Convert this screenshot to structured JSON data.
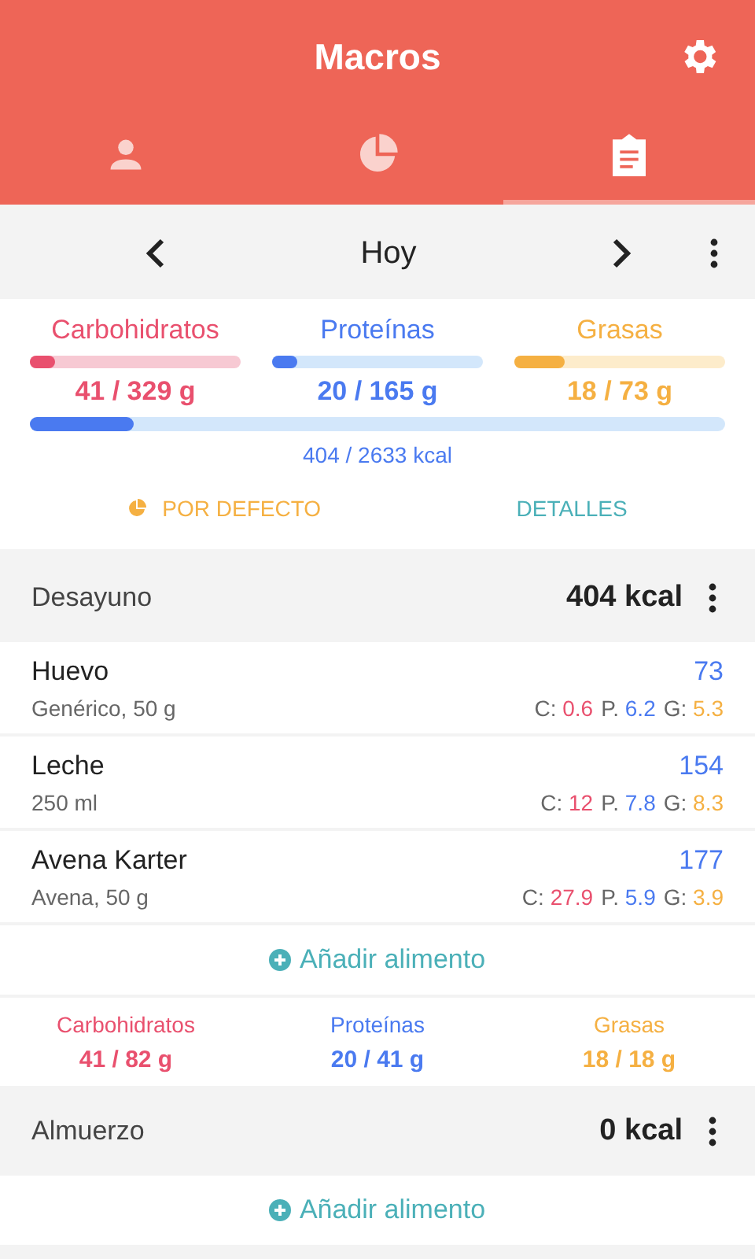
{
  "app_bar": {
    "title": "Macros"
  },
  "tabs": [
    {
      "kind": "person",
      "selected": false
    },
    {
      "kind": "pie",
      "selected": false
    },
    {
      "kind": "clipboard",
      "selected": true
    }
  ],
  "date_nav": {
    "label": "Hoy"
  },
  "summary": {
    "macros": [
      {
        "kind": "carbs",
        "label": "Carbohidratos",
        "value": "41 / 329 g",
        "level": 0.12
      },
      {
        "kind": "protein",
        "label": "Proteínas",
        "value": "20 / 165 g",
        "level": 0.12
      },
      {
        "kind": "fat",
        "label": "Grasas",
        "value": "18 / 73 g",
        "level": 0.24
      }
    ],
    "energy": {
      "level": 0.15,
      "value": "404 / 2633 kcal"
    },
    "actions": [
      {
        "kind": "preset",
        "label": "POR DEFECTO"
      },
      {
        "kind": "details",
        "label": "DETALLES"
      }
    ]
  },
  "meals": [
    {
      "name": "Desayuno",
      "kcal": "404 kcal",
      "foods": [
        {
          "name": "Huevo",
          "detail": "Genérico, 50 g",
          "kcal": "73",
          "macros": [
            {
              "kind": "carbs",
              "label": "C:",
              "value": "0.6"
            },
            {
              "kind": "protein",
              "label": "P.",
              "value": "6.2"
            },
            {
              "kind": "fat",
              "label": "G:",
              "value": "5.3"
            }
          ]
        },
        {
          "name": "Leche",
          "detail": "250 ml",
          "kcal": "154",
          "macros": [
            {
              "kind": "carbs",
              "label": "C:",
              "value": "12"
            },
            {
              "kind": "protein",
              "label": "P.",
              "value": "7.8"
            },
            {
              "kind": "fat",
              "label": "G:",
              "value": "8.3"
            }
          ]
        },
        {
          "name": "Avena Karter",
          "detail": "Avena, 50 g",
          "kcal": "177",
          "macros": [
            {
              "kind": "carbs",
              "label": "C:",
              "value": "27.9"
            },
            {
              "kind": "protein",
              "label": "P.",
              "value": "5.9"
            },
            {
              "kind": "fat",
              "label": "G:",
              "value": "3.9"
            }
          ]
        }
      ],
      "add_label": "Añadir alimento",
      "totals": [
        {
          "kind": "carbs",
          "label": "Carbohidratos",
          "value": "41 / 82 g"
        },
        {
          "kind": "protein",
          "label": "Proteínas",
          "value": "20 / 41 g"
        },
        {
          "kind": "fat",
          "label": "Grasas",
          "value": "18 / 18 g"
        }
      ]
    },
    {
      "name": "Almuerzo",
      "kcal": "0 kcal",
      "add_label": "Añadir alimento"
    }
  ]
}
